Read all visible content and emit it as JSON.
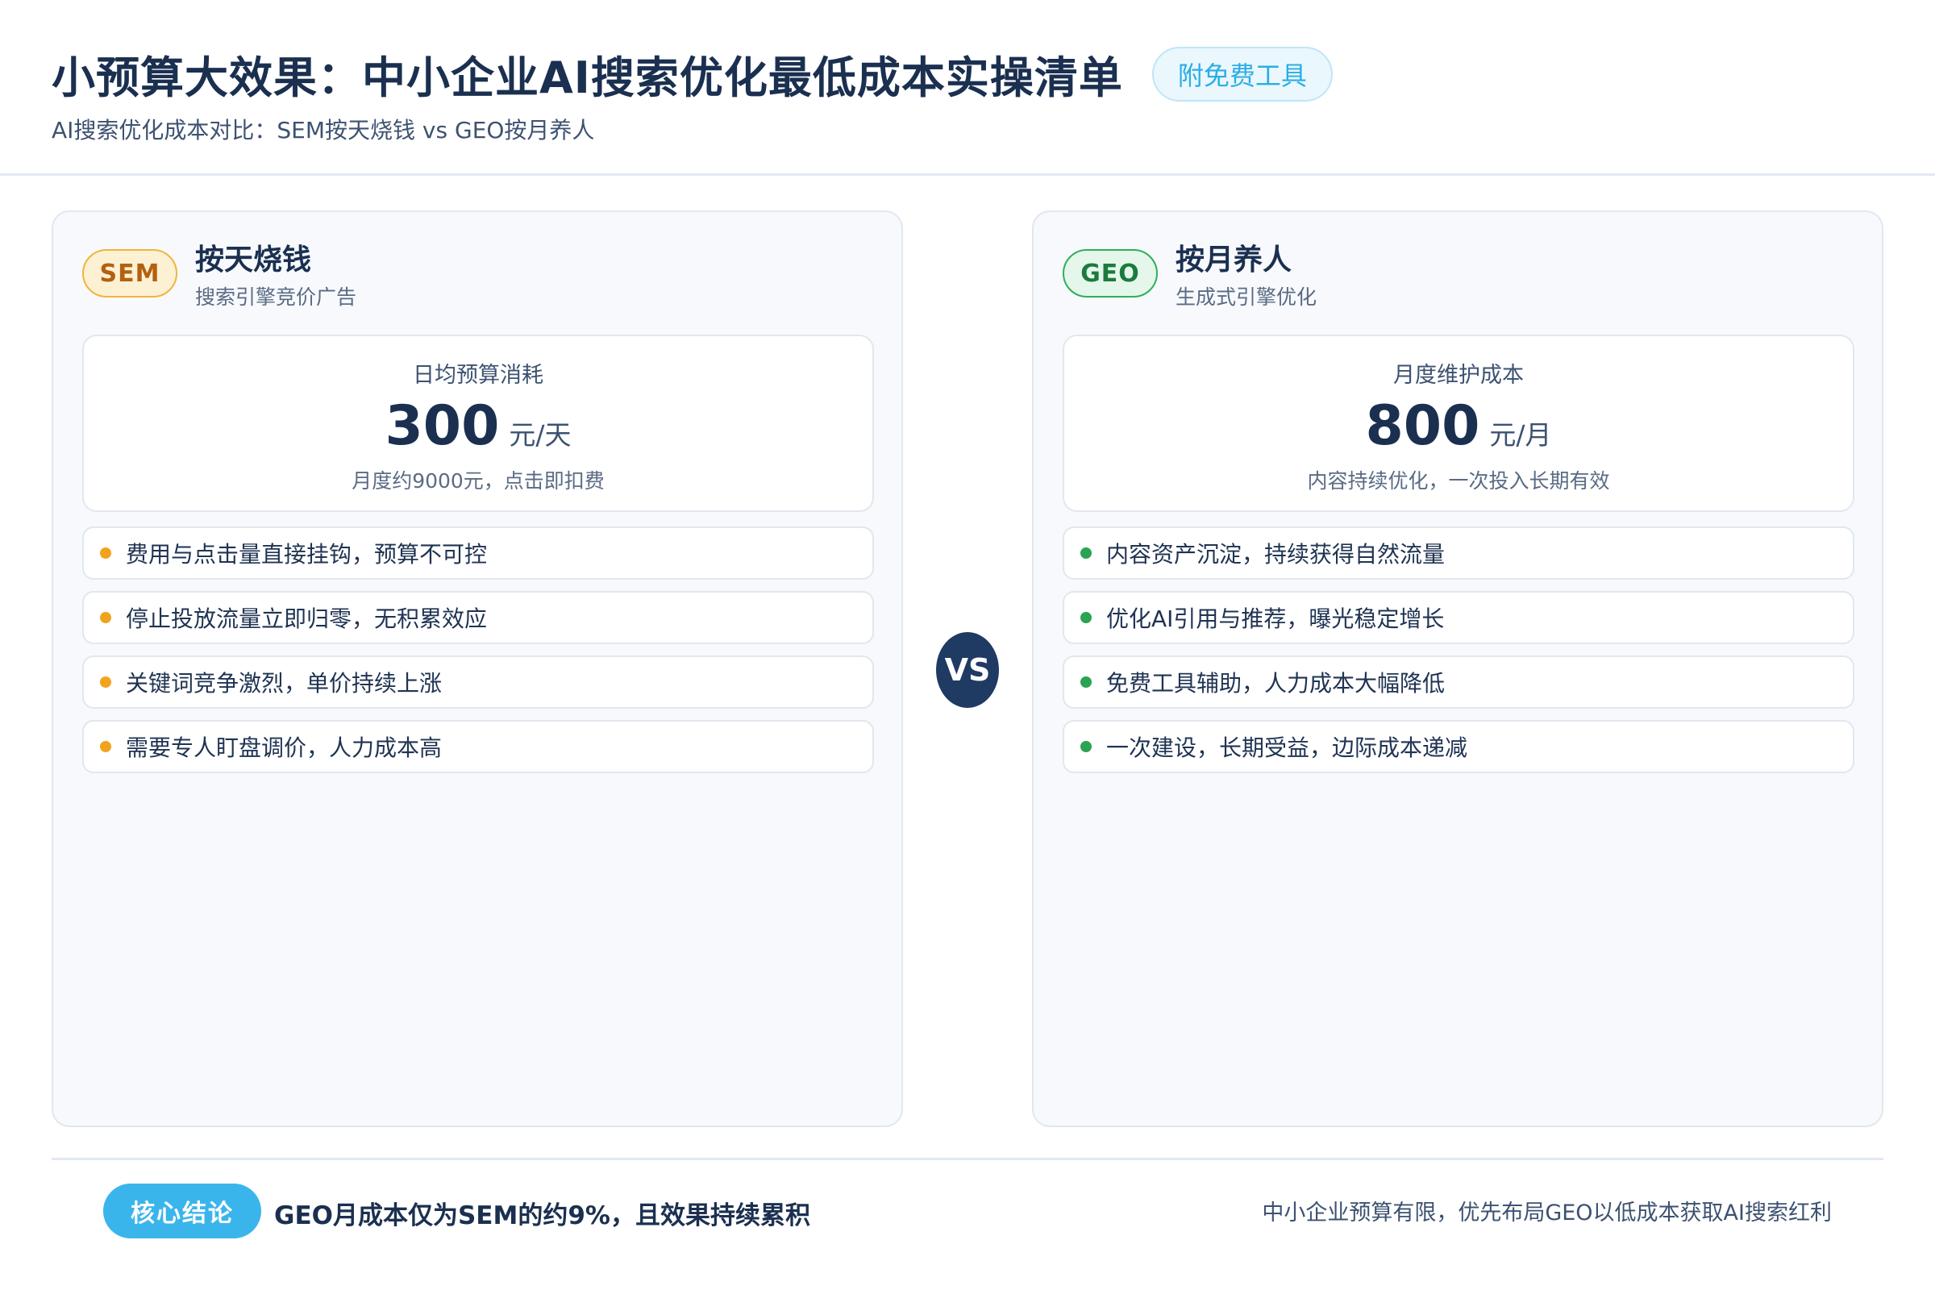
{
  "header": {
    "title": "小预算大效果：中小企业AI搜索优化最低成本实操清单",
    "badge": "附免费工具",
    "subtitle": "AI搜索优化成本对比：SEM按天烧钱 vs GEO按月养人"
  },
  "left": {
    "tag": "SEM",
    "title": "按天烧钱",
    "subtitle": "搜索引擎竞价广告",
    "cost": {
      "label": "日均预算消耗",
      "value": "300",
      "unit": "元/天",
      "note": "月度约9000元，点击即扣费"
    },
    "items": [
      "费用与点击量直接挂钩，预算不可控",
      "停止投放流量立即归零，无积累效应",
      "关键词竞争激烈，单价持续上涨",
      "需要专人盯盘调价，人力成本高"
    ],
    "accent_color": "#f2a31e"
  },
  "vs_label": "VS",
  "right": {
    "tag": "GEO",
    "title": "按月养人",
    "subtitle": "生成式引擎优化",
    "cost": {
      "label": "月度维护成本",
      "value": "800",
      "unit": "元/月",
      "note": "内容持续优化，一次投入长期有效"
    },
    "items": [
      "内容资产沉淀，持续获得自然流量",
      "优化AI引用与推荐，曝光稳定增长",
      "免费工具辅助，人力成本大幅降低",
      "一次建设，长期受益，边际成本递减"
    ],
    "accent_color": "#2aa353"
  },
  "footer": {
    "pill": "核心结论",
    "conclusion": "GEO月成本仅为SEM的约9%，且效果持续累积",
    "note": "中小企业预算有限，优先布局GEO以低成本获取AI搜索红利"
  }
}
